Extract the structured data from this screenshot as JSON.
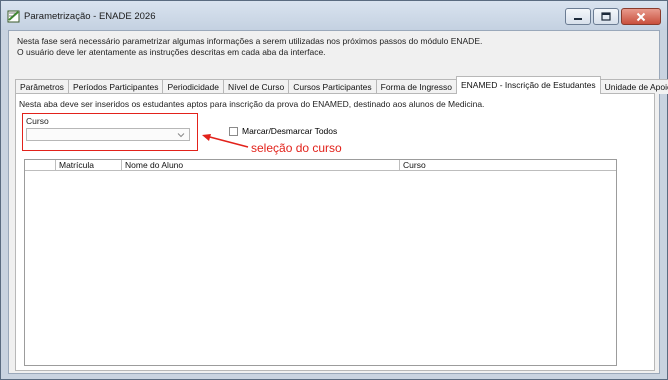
{
  "window": {
    "title": "Parametrização - ENADE 2026"
  },
  "intro": {
    "line1": "Nesta fase será necessário parametrizar algumas informações a serem utilizadas nos próximos passos do módulo ENADE.",
    "line2": "O usuário deve ler atentamente as instruções descritas em cada aba da interface."
  },
  "tabs": [
    {
      "label": "Parâmetros"
    },
    {
      "label": "Períodos Participantes"
    },
    {
      "label": "Periodicidade"
    },
    {
      "label": "Nível de Curso"
    },
    {
      "label": "Cursos Participantes"
    },
    {
      "label": "Forma de Ingresso"
    },
    {
      "label": "ENAMED - Inscrição de Estudantes",
      "active": true
    },
    {
      "label": "Unidade de Apoio"
    }
  ],
  "panel": {
    "description": "Nesta aba deve ser inseridos os estudantes aptos para inscrição da prova do ENAMED, destinado aos alunos de Medicina.",
    "curso_label": "Curso",
    "curso_value": "",
    "check_label": "Marcar/Desmarcar Todos",
    "annotation": "seleção do curso"
  },
  "grid": {
    "columns": [
      "",
      "Matrícula",
      "Nome do Aluno",
      "Curso"
    ],
    "rows": []
  },
  "colors": {
    "annotation": "#e2221b",
    "close_button": "#c9503d"
  }
}
